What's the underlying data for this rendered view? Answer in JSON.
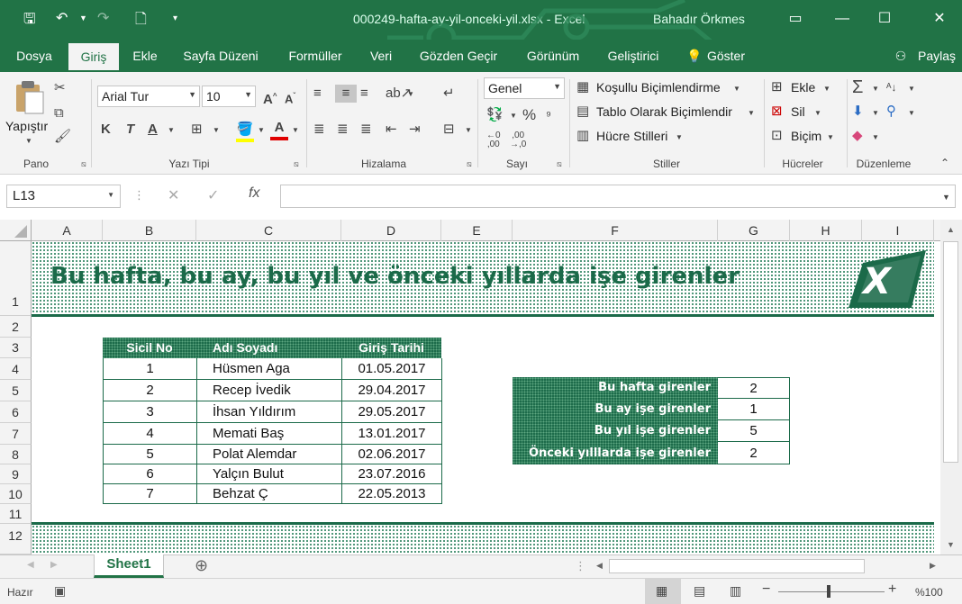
{
  "window": {
    "title": "000249-hafta-ay-yil-onceki-yil.xlsx  -  Excel",
    "user": "Bahadır Örkmes"
  },
  "tabs": [
    "Dosya",
    "Giriş",
    "Ekle",
    "Sayfa Düzeni",
    "Formüller",
    "Veri",
    "Gözden Geçir",
    "Görünüm",
    "Geliştirici",
    "Göster",
    "Paylaş"
  ],
  "ribbon": {
    "paste_label": "Yapıştır",
    "font_name": "Arial Tur",
    "font_size": "10",
    "number_format": "Genel",
    "conditional_formatting": "Koşullu Biçimlendirme",
    "format_as_table": "Tablo Olarak Biçimlendir",
    "cell_styles": "Hücre Stilleri",
    "insert": "Ekle",
    "delete": "Sil",
    "format": "Biçim",
    "bold": "K",
    "italic": "T",
    "underline": "A",
    "groups": {
      "clipboard": "Pano",
      "font": "Yazı Tipi",
      "alignment": "Hizalama",
      "number": "Sayı",
      "styles": "Stiller",
      "cells": "Hücreler",
      "editing": "Düzenleme"
    }
  },
  "formula_bar": {
    "name_box": "L13",
    "formula": "",
    "fx": "fx"
  },
  "columns": [
    "A",
    "B",
    "C",
    "D",
    "E",
    "F",
    "G",
    "H",
    "I"
  ],
  "rows": [
    "1",
    "2",
    "3",
    "4",
    "5",
    "6",
    "7",
    "8",
    "9",
    "10",
    "11",
    "12"
  ],
  "sheet": {
    "title": "Bu hafta, bu ay, bu yıl ve önceki yıllarda işe girenler",
    "logo_letter": "X",
    "table_headers": [
      "Sicil No",
      "Adı Soyadı",
      "Giriş Tarihi"
    ],
    "table_rows": [
      [
        "1",
        "Hüsmen Aga",
        "01.05.2017"
      ],
      [
        "2",
        "Recep İvedik",
        "29.04.2017"
      ],
      [
        "3",
        "İhsan Yıldırım",
        "29.05.2017"
      ],
      [
        "4",
        "Memati Baş",
        "13.01.2017"
      ],
      [
        "5",
        "Polat Alemdar",
        "02.06.2017"
      ],
      [
        "6",
        "Yalçın Bulut",
        "23.07.2016"
      ],
      [
        "7",
        "Behzat Ç",
        "22.05.2013"
      ]
    ],
    "summary": [
      {
        "label": "Bu hafta girenler",
        "value": "2"
      },
      {
        "label": "Bu ay işe girenler",
        "value": "1"
      },
      {
        "label": "Bu yıl işe girenler",
        "value": "5"
      },
      {
        "label": "Önceki yılllarda işe girenler",
        "value": "2"
      }
    ]
  },
  "sheet_tabs": [
    "Sheet1"
  ],
  "status": {
    "ready": "Hazır",
    "zoom": "%100"
  },
  "colors": {
    "accent": "#217346",
    "dark_green": "#1b6a49"
  }
}
